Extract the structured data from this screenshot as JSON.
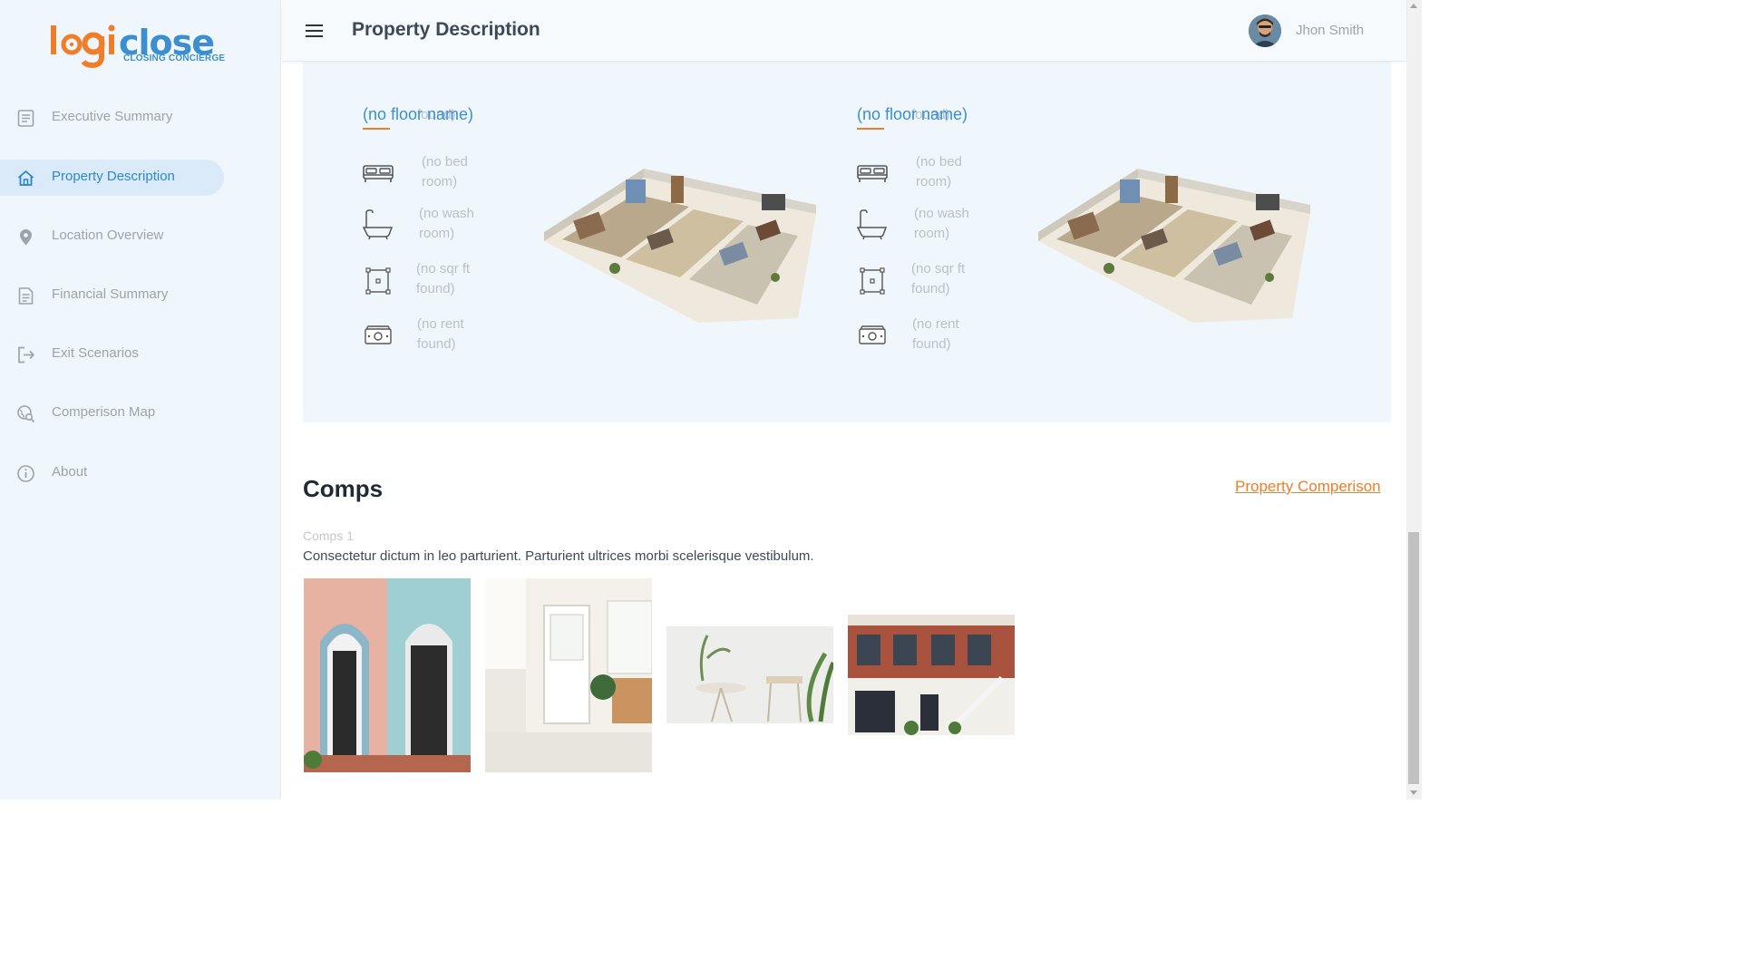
{
  "app": {
    "logo_text": "logiclose",
    "logo_tagline": "CLOSING CONCIERGE",
    "brand_colors": {
      "primary": "#3b8fd1",
      "accent": "#ef7d2a"
    }
  },
  "sidebar": {
    "items": [
      {
        "label": "Executive Summary",
        "icon": "document-icon",
        "active": false
      },
      {
        "label": "Property Description",
        "icon": "home-icon",
        "active": true
      },
      {
        "label": "Location Overview",
        "icon": "location-pin-icon",
        "active": false
      },
      {
        "label": "Financial Summary",
        "icon": "document-icon",
        "active": false
      },
      {
        "label": "Exit Scenarios",
        "icon": "exit-icon",
        "active": false
      },
      {
        "label": "Comperison Map",
        "icon": "map-search-icon",
        "active": false
      },
      {
        "label": "About",
        "icon": "info-icon",
        "active": false
      }
    ]
  },
  "header": {
    "title": "Property Description",
    "user_name": "Jhon Smith"
  },
  "floor_plans": [
    {
      "cut_off_text": "found)",
      "name": "(no floor name)",
      "bedrooms": "(no bed room)",
      "washrooms": "(no wash room)",
      "sqft": "(no sqr ft found)",
      "rent": "(no rent found)"
    },
    {
      "cut_off_text": "found)",
      "name": "(no floor name)",
      "bedrooms": "(no bed room)",
      "washrooms": "(no wash room)",
      "sqft": "(no sqr ft found)",
      "rent": "(no rent found)"
    }
  ],
  "comps": {
    "title": "Comps",
    "link_label": "Property Comperison",
    "subtitle": "Comps 1",
    "description": "Consectetur dictum in leo parturient. Parturient ultrices morbi scelerisque vestibulum."
  }
}
